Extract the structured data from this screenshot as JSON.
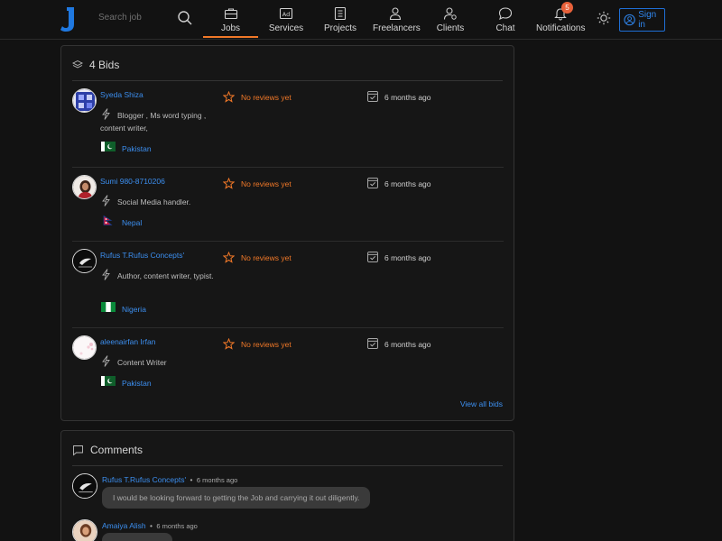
{
  "header": {
    "search_placeholder": "Search job",
    "nav": [
      {
        "label": "Jobs",
        "icon": "briefcase-icon"
      },
      {
        "label": "Services",
        "icon": "ad-icon"
      },
      {
        "label": "Projects",
        "icon": "notebook-icon"
      },
      {
        "label": "Freelancers",
        "icon": "person-icon"
      },
      {
        "label": "Clients",
        "icon": "person-gear-icon"
      },
      {
        "label": "Chat",
        "icon": "chat-bubble-icon"
      },
      {
        "label": "Notifications",
        "icon": "bell-icon",
        "badge": "5"
      }
    ],
    "active_nav": "Jobs",
    "signin_label": "Sign in",
    "accent_color": "#f07828",
    "link_color": "#3c8ff0"
  },
  "bids": {
    "title": "4 Bids",
    "items": [
      {
        "name": "Syeda Shiza",
        "skills": "Blogger , Ms word typing , content writer,",
        "country": "Pakistan",
        "reviews": "No reviews yet",
        "time": "6 months ago"
      },
      {
        "name": "Sumi 980-8710206",
        "skills": "Social Media handler.",
        "country": "Nepal",
        "reviews": "No reviews yet",
        "time": "6 months ago"
      },
      {
        "name": "Rufus T.Rufus Concepts'",
        "skills": "Author, content writer, typist.",
        "country": "Nigeria",
        "reviews": "No reviews yet",
        "time": "6 months ago"
      },
      {
        "name": "aleenairfan Irfan",
        "skills": "Content Writer",
        "country": "Pakistan",
        "reviews": "No reviews yet",
        "time": "6 months ago"
      }
    ],
    "view_all": "View all bids"
  },
  "comments": {
    "title": "Comments",
    "items": [
      {
        "name": "Rufus T.Rufus Concepts'",
        "separator": "•",
        "time": "6 months ago",
        "text": "I would be looking forward to getting the Job and carrying it out diligently."
      },
      {
        "name": "Amaiya Alish",
        "separator": "•",
        "time": "6 months ago",
        "text": ""
      }
    ]
  }
}
